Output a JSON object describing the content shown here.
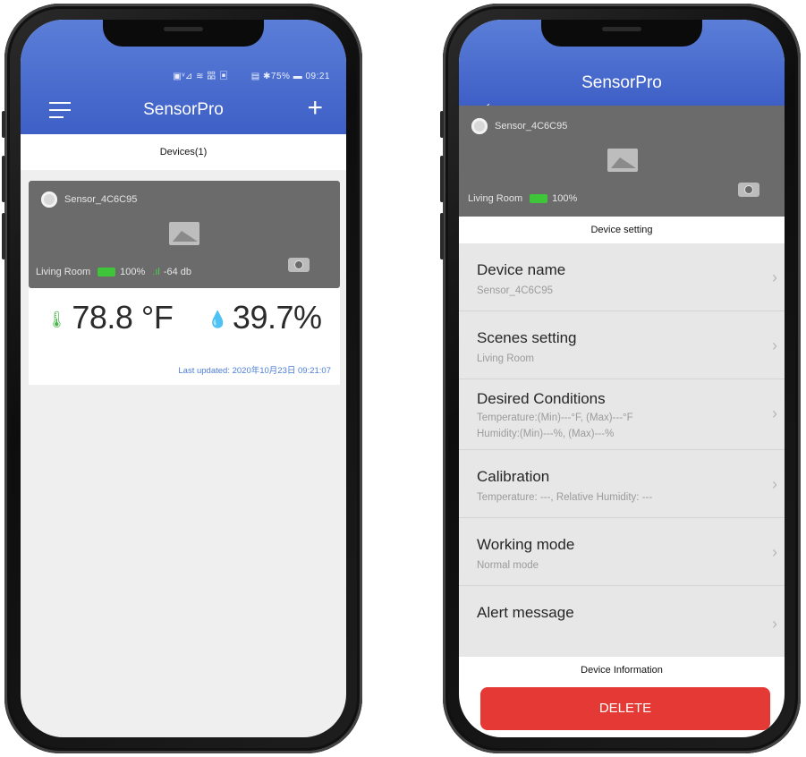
{
  "colors": {
    "appbar": "#4a6cd0",
    "delete": "#e53935",
    "battery": "#3fc53a",
    "link": "#4c7ed6"
  },
  "left": {
    "status_left": "▣ᵛ⊿ ≋ 㗊 ▣",
    "status_right": "▤ ✱75% ▬ 09:21",
    "title": "SensorPro",
    "section": "Devices(1)",
    "device": {
      "name": "Sensor_4C6C95",
      "room": "Living Room",
      "battery": "100%",
      "signal": "-64 db",
      "temperature": "78.8 °F",
      "humidity": "39.7%",
      "updated": "Last updated: 2020年10月23日 09:21:07"
    }
  },
  "right": {
    "title": "SensorPro",
    "device_name": "Sensor_4C6C95",
    "room": "Living Room",
    "battery": "100%",
    "section": "Device setting",
    "settings": [
      {
        "title": "Device name",
        "sub": "Sensor_4C6C95",
        "sub2": ""
      },
      {
        "title": "Scenes setting",
        "sub": "Living Room",
        "sub2": ""
      },
      {
        "title": "Desired Conditions",
        "sub": "Temperature:(Min)---°F, (Max)---°F",
        "sub2": "Humidity:(Min)---%, (Max)---%"
      },
      {
        "title": "Calibration",
        "sub": "Temperature: ---, Relative Humidity: ---",
        "sub2": ""
      },
      {
        "title": "Working mode",
        "sub": "Normal mode",
        "sub2": ""
      },
      {
        "title": "Alert message",
        "sub": "",
        "sub2": ""
      }
    ],
    "info_section": "Device Information",
    "delete_label": "DELETE"
  }
}
